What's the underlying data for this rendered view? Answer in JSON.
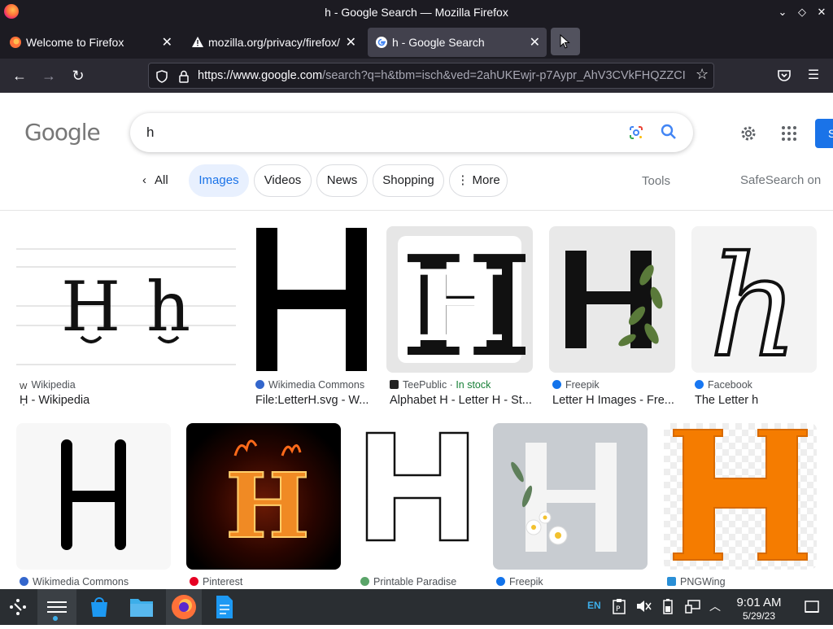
{
  "window": {
    "title": "h - Google Search — Mozilla Firefox"
  },
  "tabs": [
    {
      "label": "Welcome to Firefox",
      "icon": "firefox-icon"
    },
    {
      "label": "mozilla.org/privacy/firefox/",
      "icon": "warning-icon"
    },
    {
      "label": "h - Google Search",
      "icon": "google-icon",
      "active": true
    }
  ],
  "navbar": {
    "url_host": "https://www.google.com",
    "url_rest": "/search?q=h&tbm=isch&ved=2ahUKEwjr-p7Aypr_AhV3CVkFHQZZCI"
  },
  "google": {
    "logo": "Google",
    "query": "h",
    "sign_in": "S",
    "filters": {
      "all": "All",
      "chips": [
        "Images",
        "Videos",
        "News",
        "Shopping",
        "More"
      ],
      "tools": "Tools",
      "safesearch": "SafeSearch on"
    }
  },
  "results": [
    {
      "source": "Wikipedia",
      "caption": "Ḥ - Wikipedia",
      "fav_color": "#333333"
    },
    {
      "source": "Wikimedia Commons",
      "caption": "File:LetterH.svg - W...",
      "fav_color": "#3366cc"
    },
    {
      "source": "TeePublic",
      "stock": "In stock",
      "caption": "Alphabet H - Letter H - St...",
      "fav_color": "#222222"
    },
    {
      "source": "Freepik",
      "caption": "Letter H Images - Fre...",
      "fav_color": "#1273eb"
    },
    {
      "source": "Facebook",
      "caption": "The Letter h",
      "fav_color": "#1877f2"
    },
    {
      "source": "Wikimedia Commons",
      "caption": "",
      "fav_color": "#3366cc"
    },
    {
      "source": "Pinterest",
      "caption": "",
      "fav_color": "#e60023"
    },
    {
      "source": "Printable Paradise",
      "caption": "",
      "fav_color": "#5aa469"
    },
    {
      "source": "Freepik",
      "caption": "",
      "fav_color": "#1273eb"
    },
    {
      "source": "PNGWing",
      "caption": "",
      "fav_color": "#2a8fd6"
    }
  ],
  "taskbar": {
    "lang": "EN",
    "time": "9:01 AM",
    "date": "5/29/23"
  }
}
